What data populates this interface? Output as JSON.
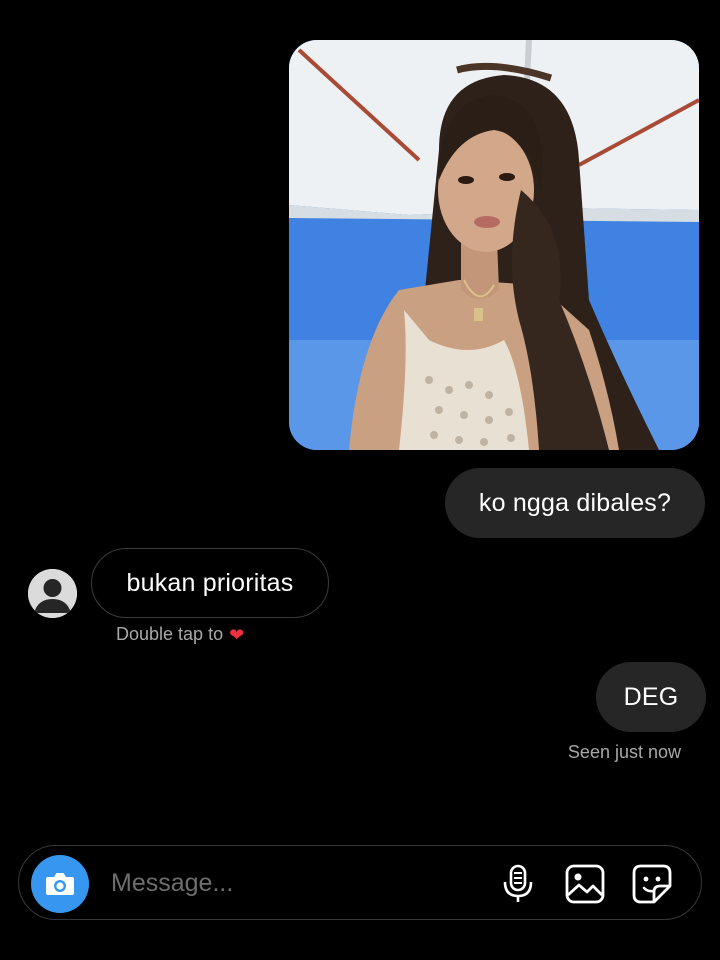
{
  "messages": {
    "sent_1": "ko ngga dibales?",
    "received_1": "bukan prioritas",
    "double_tap_hint": "Double tap to",
    "sent_2": "DEG",
    "seen_status": "Seen just now"
  },
  "composer": {
    "placeholder": "Message...",
    "icons": [
      "camera-icon",
      "microphone-icon",
      "gallery-icon",
      "sticker-icon"
    ]
  },
  "colors": {
    "background": "#000000",
    "sent_bubble": "#262626",
    "camera_button": "#3797f0",
    "heart": "#ed2f3f",
    "muted_text": "#a8a8a8"
  }
}
